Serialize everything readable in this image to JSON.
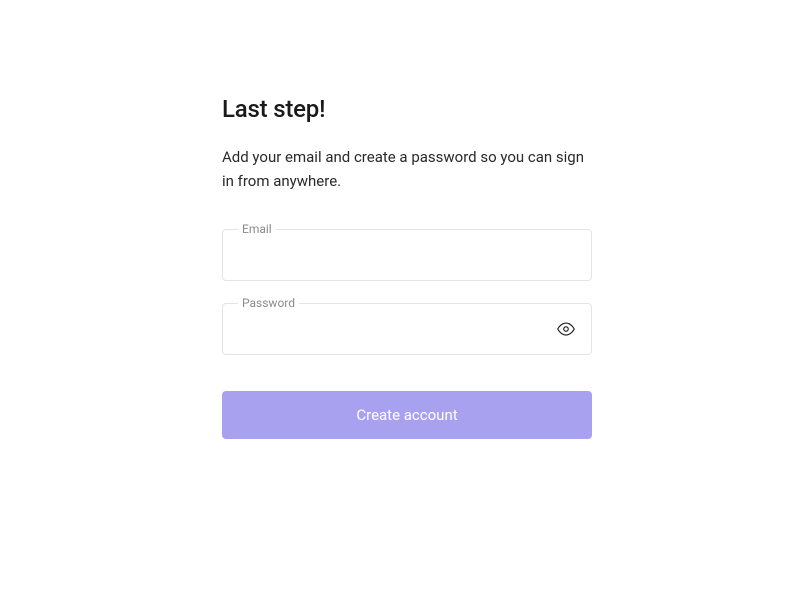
{
  "title": "Last step!",
  "subtitle": "Add your email and create a password so you can sign in from anywhere.",
  "fields": {
    "email": {
      "label": "Email",
      "value": ""
    },
    "password": {
      "label": "Password",
      "value": ""
    }
  },
  "submitLabel": "Create account",
  "colors": {
    "accent": "#a8a1f0"
  }
}
